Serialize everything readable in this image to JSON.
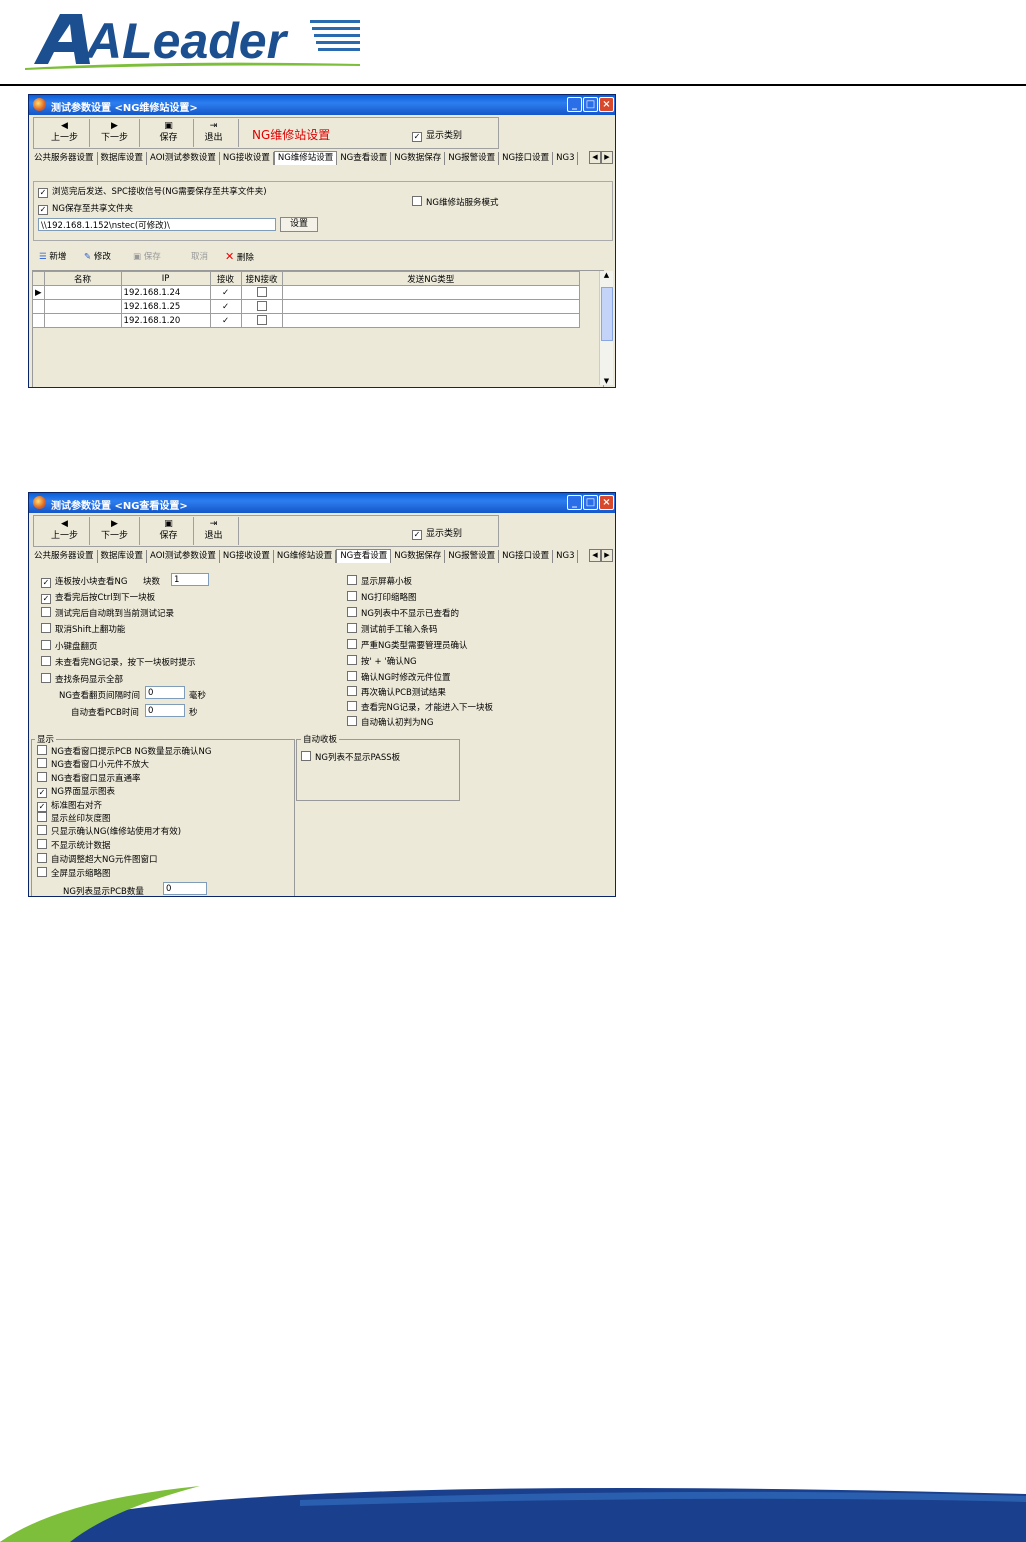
{
  "header": {
    "logo_text": "ALeader"
  },
  "window1": {
    "title": "测试参数设置 <NG维修站设置>",
    "toolbar": {
      "prev": "上一步",
      "next": "下一步",
      "save": "保存",
      "exit": "退出",
      "title": "NG维修站设置",
      "show_category": "显示类别",
      "show_category_checked": true
    },
    "tabs": [
      "公共服务器设置",
      "数据库设置",
      "AOI测试参数设置",
      "NG接收设置",
      "NG维修站设置",
      "NG查看设置",
      "NG数据保存",
      "NG报警设置",
      "NG接口设置",
      "NG3"
    ],
    "active_tab": 4,
    "options": {
      "send_after_browse": "浏览完后发送、SPC接收信号(NG需要保存至共享文件夹)",
      "send_after_browse_checked": true,
      "save_shared": "NG保存至共享文件夹",
      "save_shared_checked": true,
      "service_mode": "NG维修站服务模式",
      "service_mode_checked": false,
      "path_value": "\\\\192.168.1.152\\nstec(可修改)\\",
      "set_button": "设置"
    },
    "edit_bar": {
      "add": "新增",
      "modify": "修改",
      "save": "保存",
      "cancel": "取消",
      "delete": "删除"
    },
    "grid": {
      "headers": [
        "名称",
        "IP",
        "接收",
        "接N接收",
        "发送NG类型"
      ],
      "rows": [
        {
          "name": "",
          "ip": "192.168.1.24",
          "recv": true,
          "recv_n": false,
          "ng_type": ""
        },
        {
          "name": "",
          "ip": "192.168.1.25",
          "recv": true,
          "recv_n": false,
          "ng_type": ""
        },
        {
          "name": "",
          "ip": "192.168.1.20",
          "recv": true,
          "recv_n": false,
          "ng_type": ""
        }
      ]
    }
  },
  "window2": {
    "title": "测试参数设置 <NG查看设置>",
    "toolbar": {
      "prev": "上一步",
      "next": "下一步",
      "save": "保存",
      "exit": "退出",
      "show_category": "显示类别",
      "show_category_checked": true
    },
    "tabs": [
      "公共服务器设置",
      "数据库设置",
      "AOI测试参数设置",
      "NG接收设置",
      "NG维修站设置",
      "NG查看设置",
      "NG数据保存",
      "NG报警设置",
      "NG接口设置",
      "NG3"
    ],
    "active_tab": 5,
    "left_options": [
      {
        "label": "连板按小块查看NG",
        "checked": true
      },
      {
        "label": "查看完后按Ctrl到下一块板",
        "checked": true
      },
      {
        "label": "测试完后自动跳到当前测试记录",
        "checked": false
      },
      {
        "label": "取消Shift上翻功能",
        "checked": false
      },
      {
        "label": "小键盘翻页",
        "checked": false
      },
      {
        "label": "未查看完NG记录，按下一块板时提示",
        "checked": false
      },
      {
        "label": "查找条码显示全部",
        "checked": false
      }
    ],
    "block_count_label": "块数",
    "block_count_value": "1",
    "interval_label": "NG查看翻页间隔时间",
    "interval_value": "0",
    "interval_unit": "毫秒",
    "auto_view_label": "自动查看PCB时间",
    "auto_view_value": "0",
    "auto_view_unit": "秒",
    "right_options": [
      {
        "label": "显示屏幕小板",
        "checked": false
      },
      {
        "label": "NG打印缩略图",
        "checked": false
      },
      {
        "label": "NG列表中不显示已查看的",
        "checked": false
      },
      {
        "label": "测试前手工输入条码",
        "checked": false
      },
      {
        "label": "严重NG类型需要管理员确认",
        "checked": false
      },
      {
        "label": "按' + '确认NG",
        "checked": false
      },
      {
        "label": "确认NG时修改元件位置",
        "checked": false
      },
      {
        "label": "再次确认PCB测试结果",
        "checked": false
      },
      {
        "label": "查看完NG记录，才能进入下一块板",
        "checked": false
      },
      {
        "label": "自动确认初判为NG",
        "checked": false
      }
    ],
    "display_group": {
      "legend": "显示",
      "options": [
        {
          "label": "NG查看窗口提示PCB NG数量显示确认NG",
          "checked": false
        },
        {
          "label": "NG查看窗口小元件不放大",
          "checked": false
        },
        {
          "label": "NG查看窗口显示直通率",
          "checked": false
        },
        {
          "label": "NG界面显示图表",
          "checked": true
        },
        {
          "label": "标准图右对齐",
          "checked": true
        },
        {
          "label": "显示丝印灰度图",
          "checked": false
        },
        {
          "label": "只显示确认NG(维修站使用才有效)",
          "checked": false
        },
        {
          "label": "不显示统计数据",
          "checked": false
        },
        {
          "label": "自动调整超大NG元件图窗口",
          "checked": false
        },
        {
          "label": "全屏显示缩略图",
          "checked": false
        }
      ],
      "pcb_count_label": "NG列表显示PCB数量",
      "pcb_count_value": "0"
    },
    "auto_group": {
      "legend": "自动收板",
      "option": "NG列表不显示PASS板",
      "option_checked": false
    }
  }
}
